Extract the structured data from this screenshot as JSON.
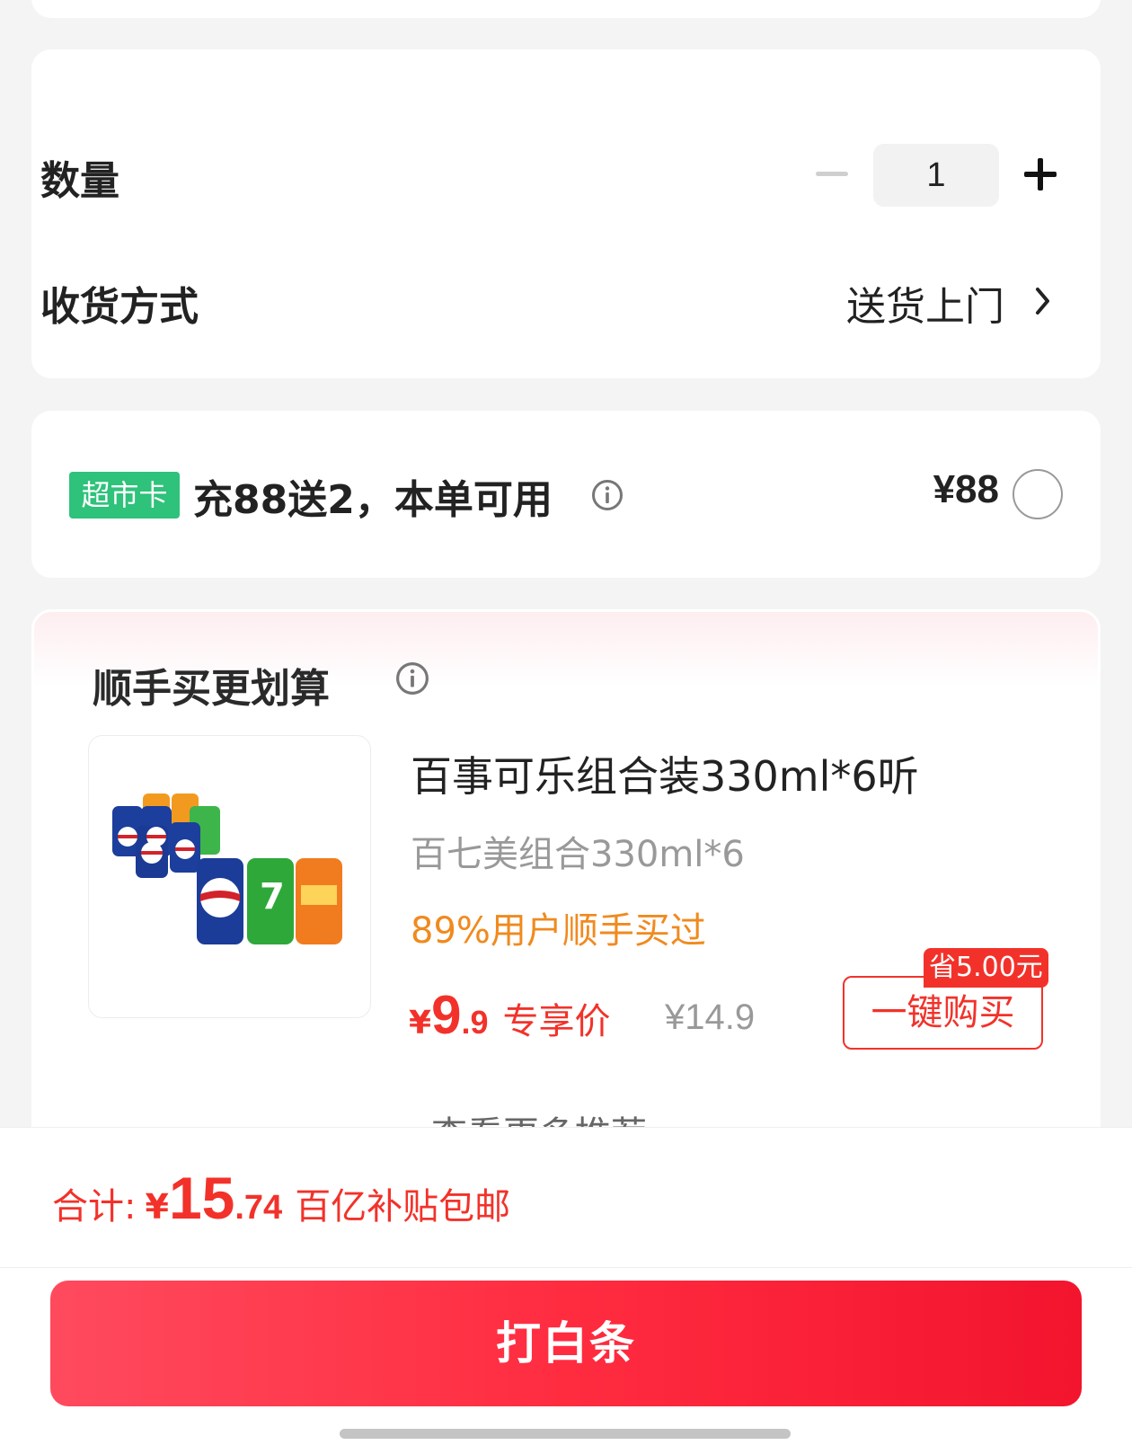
{
  "quantity_section": {
    "label": "数量",
    "value": "1",
    "shipping_label": "收货方式",
    "shipping_value": "送货上门"
  },
  "card_offer": {
    "badge": "超市卡",
    "text": "充88送2，本单可用",
    "price": "¥88"
  },
  "recommendation": {
    "title": "顺手买更划算",
    "product_name": "百事可乐组合装330ml*6听",
    "product_sub": "百七美组合330ml*6",
    "popularity": "89%用户顺手买过",
    "price_symbol": "¥",
    "price_int": "9",
    "price_dec": ".9",
    "price_tag": "专享价",
    "original_price": "¥14.9",
    "save_badge": "省5.00元",
    "buy_button": "一键购买",
    "more_link": "查看更多推荐"
  },
  "summary": {
    "total_label": "合计:",
    "total_symbol": "¥",
    "total_int": "15",
    "total_dec": ".74",
    "total_note": "百亿补贴包邮"
  },
  "pay_button": "打白条",
  "colors": {
    "accent_red": "#f2322a",
    "badge_green": "#2ec27a",
    "popularity_orange": "#f08a1e"
  },
  "icons": [
    "minus-icon",
    "plus-icon",
    "chevron-right-icon",
    "info-icon",
    "radio-icon",
    "chevron-down-icon"
  ]
}
